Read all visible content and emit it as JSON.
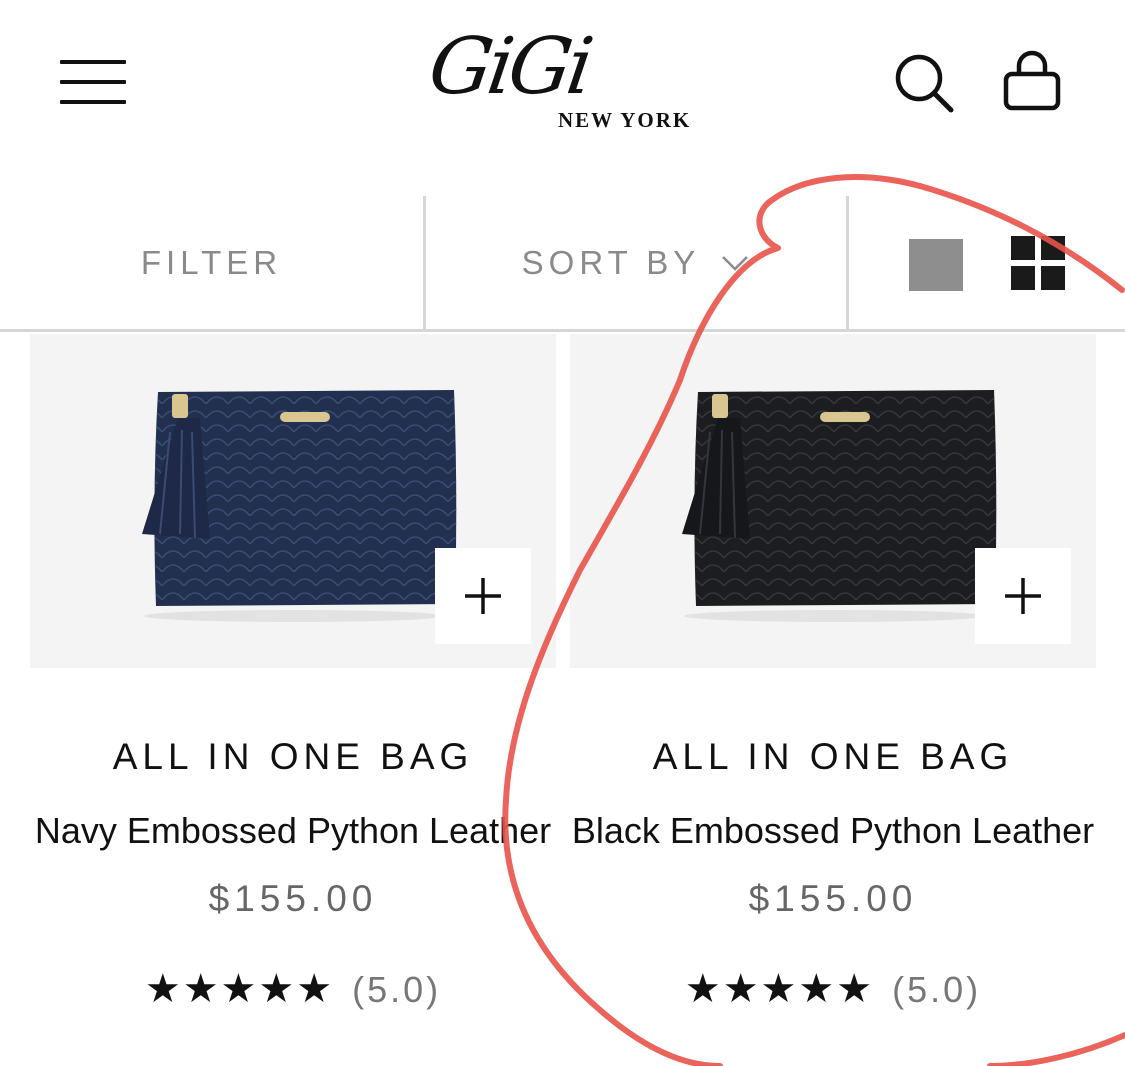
{
  "header": {
    "logo_main": "GiGi",
    "logo_sub": "NEW YORK"
  },
  "toolbar": {
    "filter_label": "FILTER",
    "sort_label": "SORT BY"
  },
  "products": [
    {
      "brand": "ALL IN ONE BAG",
      "name": "Navy Embossed Python Leather",
      "price": "$155.00",
      "stars": "★★★★★",
      "rating": "(5.0)",
      "add_label": "+",
      "color": "#22304f"
    },
    {
      "brand": "ALL IN ONE BAG",
      "name": "Black Embossed Python Leather",
      "price": "$155.00",
      "stars": "★★★★★",
      "rating": "(5.0)",
      "add_label": "+",
      "color": "#1c1d20"
    }
  ],
  "colors": {
    "annotation": "#e8534a",
    "active_view": "#1a1a1a",
    "inactive_view": "#8e8e8e"
  }
}
